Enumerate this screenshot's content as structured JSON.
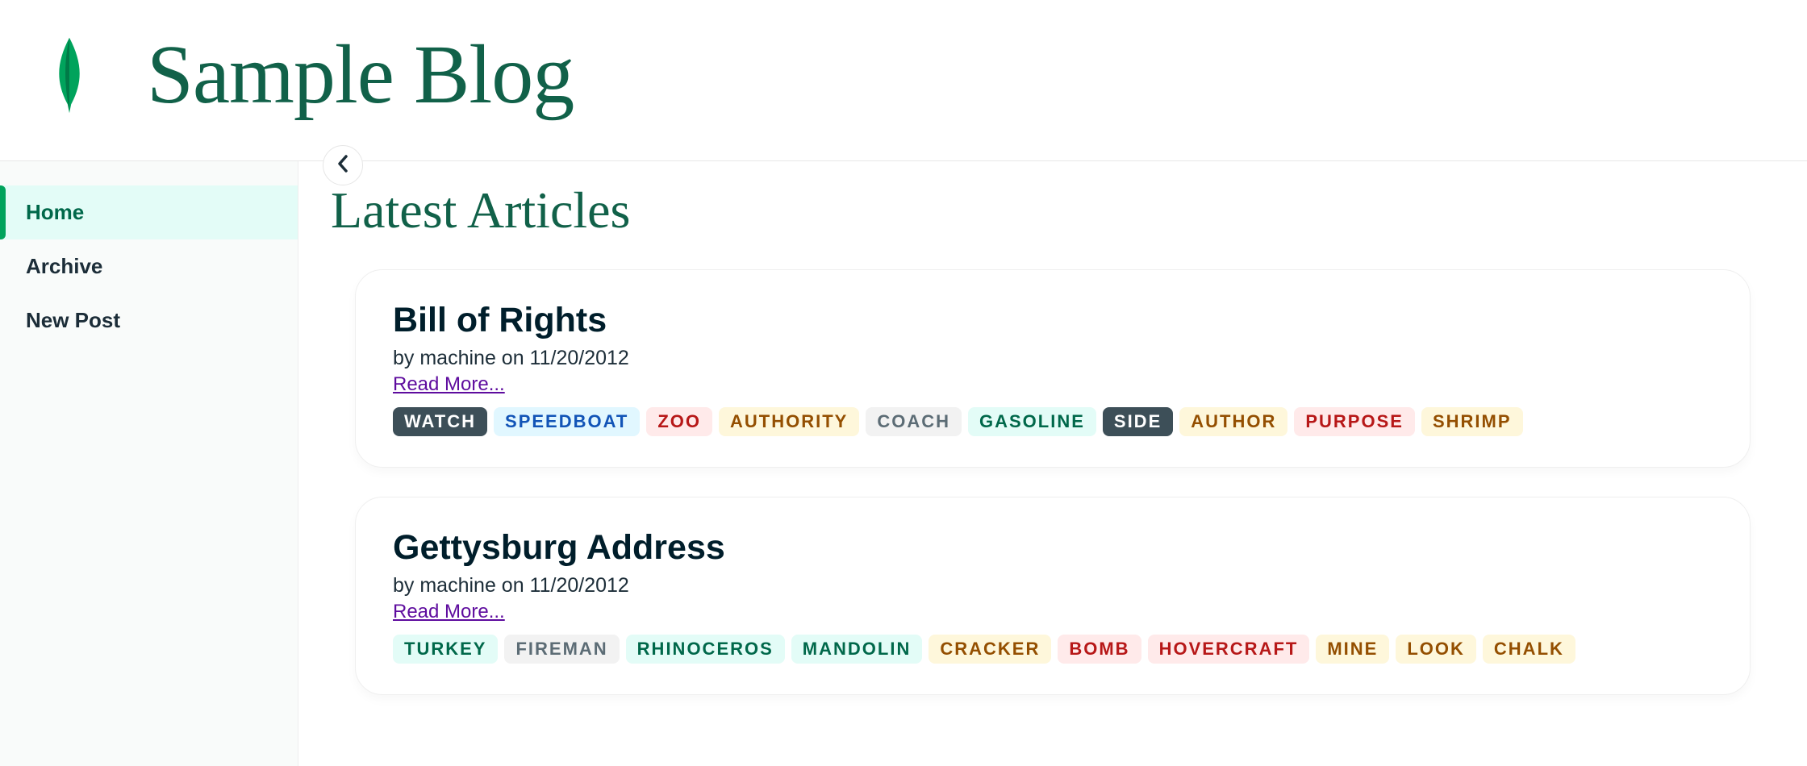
{
  "site": {
    "title": "Sample Blog"
  },
  "nav": {
    "items": [
      {
        "label": "Home",
        "active": true
      },
      {
        "label": "Archive",
        "active": false
      },
      {
        "label": "New Post",
        "active": false
      }
    ]
  },
  "page": {
    "title": "Latest Articles"
  },
  "read_more_label": "Read More...",
  "posts": [
    {
      "title": "Bill of Rights",
      "byline": "by machine on 11/20/2012",
      "tags": [
        {
          "text": "WATCH",
          "variant": "white-dark"
        },
        {
          "text": "SPEEDBOAT",
          "variant": "blue-light"
        },
        {
          "text": "ZOO",
          "variant": "red-light"
        },
        {
          "text": "AUTHORITY",
          "variant": "yellow-light"
        },
        {
          "text": "COACH",
          "variant": "gray-light"
        },
        {
          "text": "GASOLINE",
          "variant": "green-light"
        },
        {
          "text": "SIDE",
          "variant": "white-dark"
        },
        {
          "text": "AUTHOR",
          "variant": "yellow-light"
        },
        {
          "text": "PURPOSE",
          "variant": "red-light"
        },
        {
          "text": "SHRIMP",
          "variant": "yellow-light"
        }
      ]
    },
    {
      "title": "Gettysburg Address",
      "byline": "by machine on 11/20/2012",
      "tags": [
        {
          "text": "TURKEY",
          "variant": "green-light"
        },
        {
          "text": "FIREMAN",
          "variant": "gray-light"
        },
        {
          "text": "RHINOCEROS",
          "variant": "green-light"
        },
        {
          "text": "MANDOLIN",
          "variant": "green-light"
        },
        {
          "text": "CRACKER",
          "variant": "yellow-light"
        },
        {
          "text": "BOMB",
          "variant": "red-light"
        },
        {
          "text": "HOVERCRAFT",
          "variant": "red-light"
        },
        {
          "text": "MINE",
          "variant": "yellow-light"
        },
        {
          "text": "LOOK",
          "variant": "yellow-light"
        },
        {
          "text": "CHALK",
          "variant": "yellow-light"
        }
      ]
    }
  ]
}
